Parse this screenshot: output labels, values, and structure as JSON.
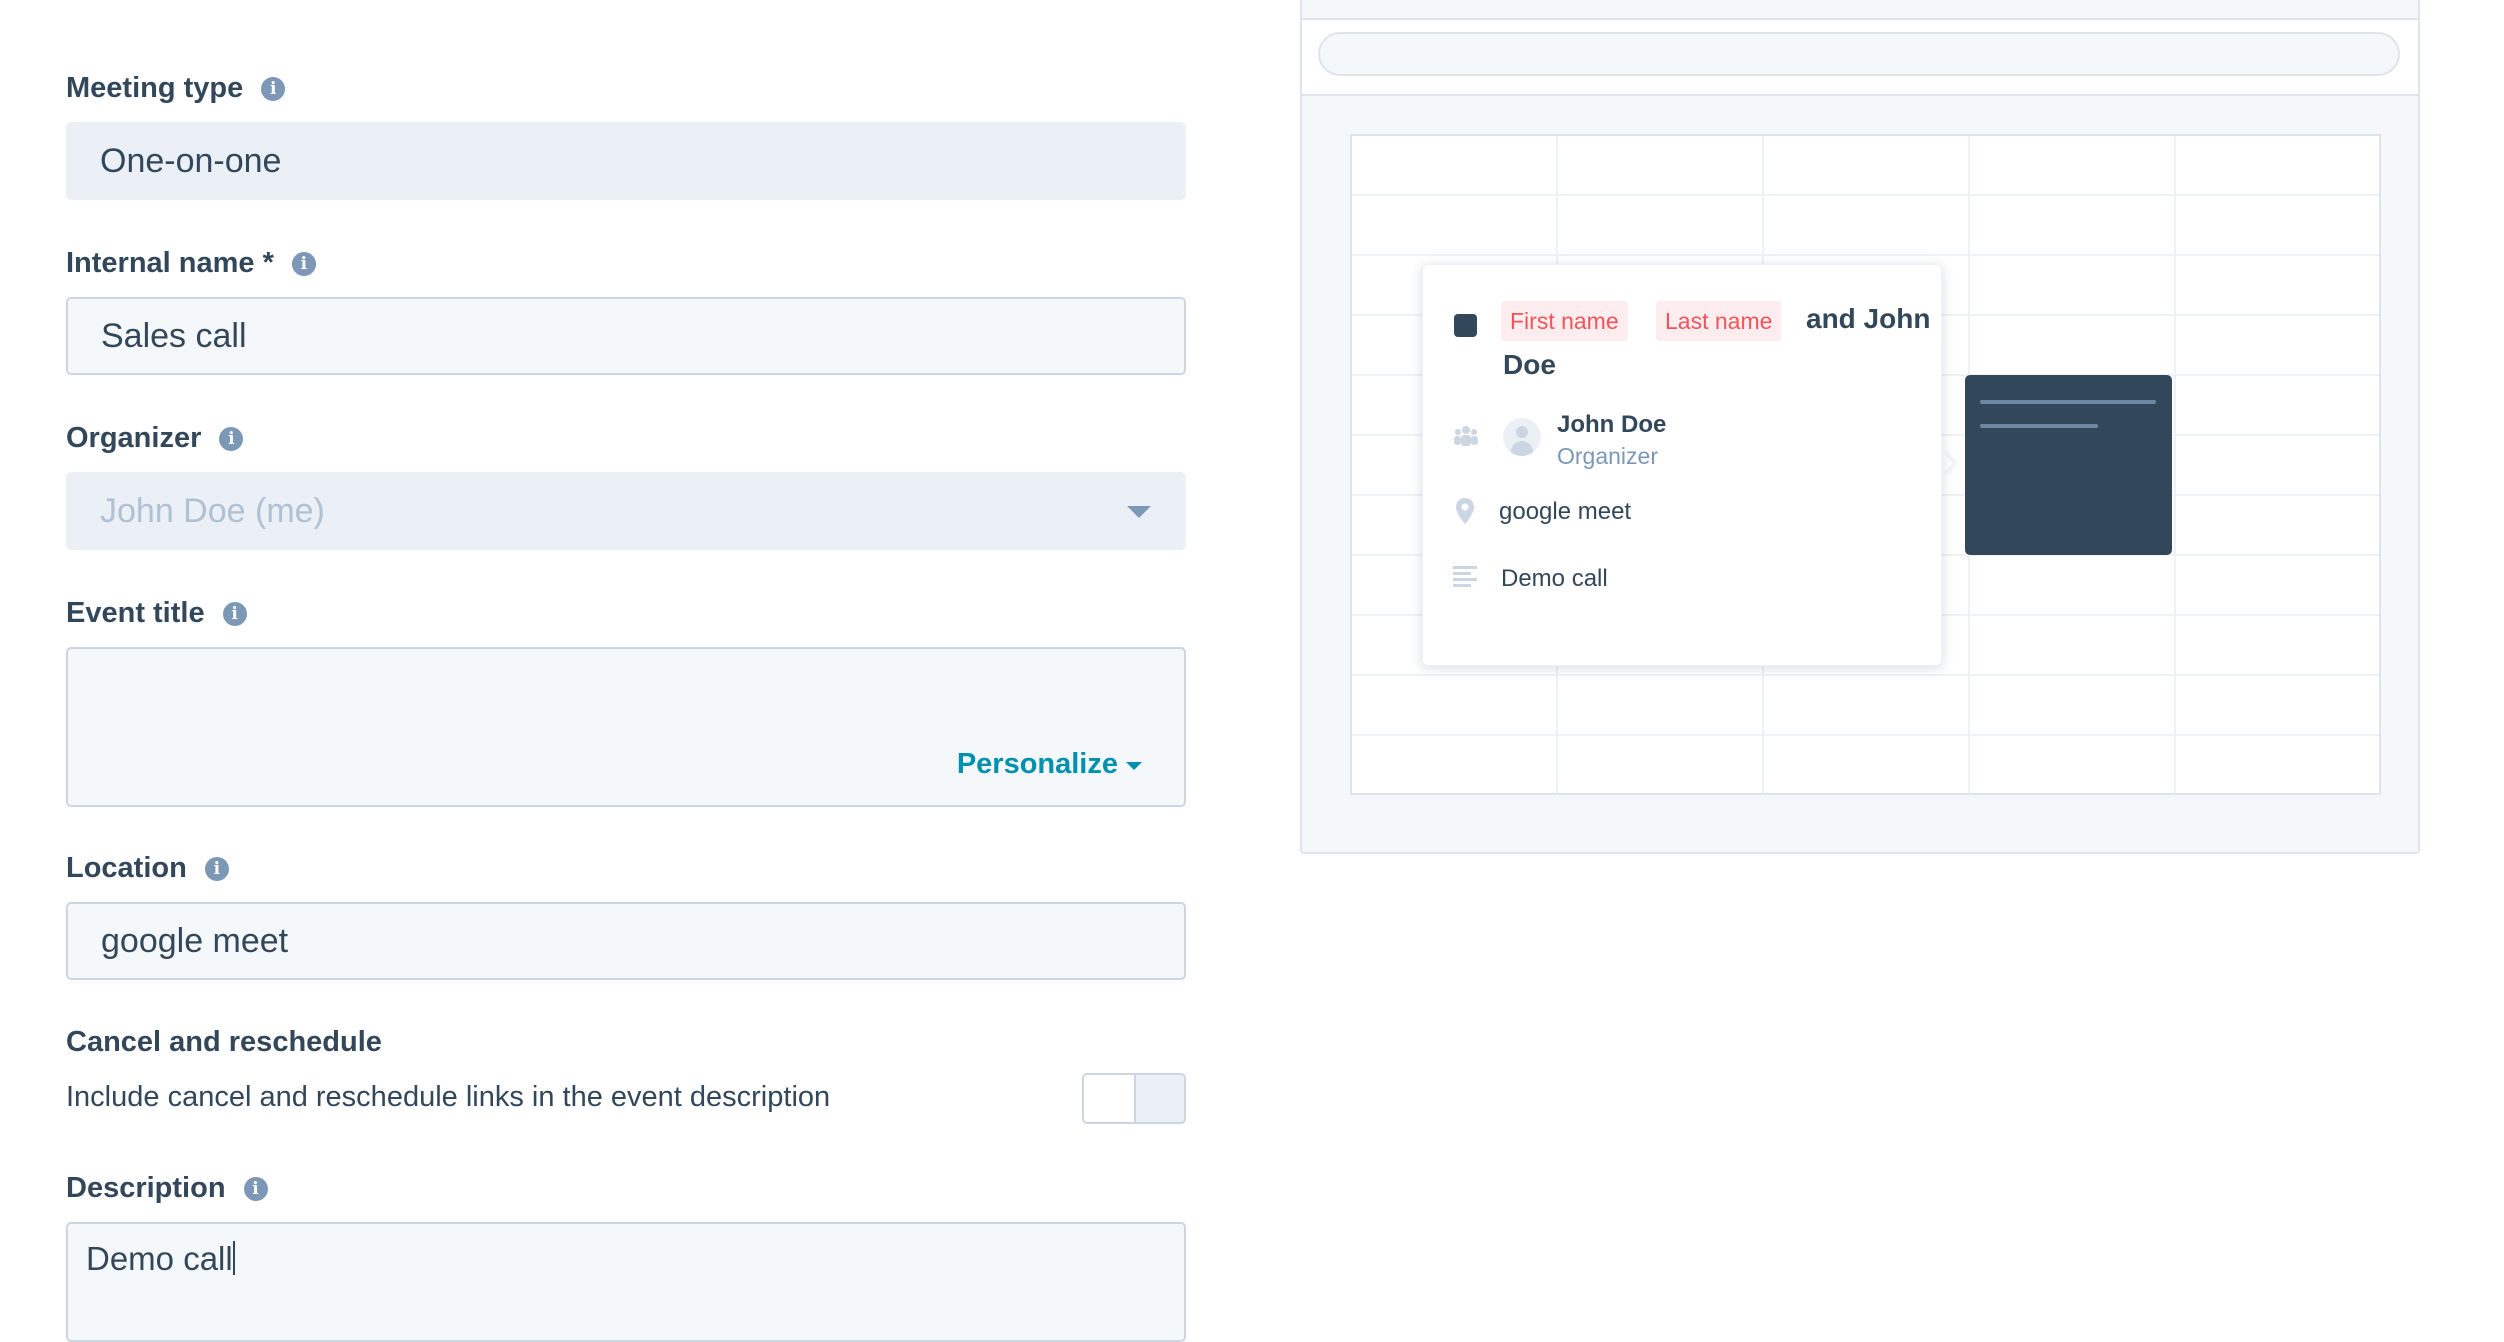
{
  "form": {
    "meeting_type": {
      "label": "Meeting type",
      "value": "One-on-one"
    },
    "internal_name": {
      "label": "Internal name *",
      "value": "Sales call"
    },
    "organizer": {
      "label": "Organizer",
      "value": "John Doe (me)"
    },
    "event_title": {
      "label": "Event title",
      "value": "",
      "personalize_label": "Personalize"
    },
    "location": {
      "label": "Location",
      "value": "google meet"
    },
    "cancel_reschedule": {
      "label": "Cancel and reschedule",
      "description": "Include cancel and reschedule links in the event description",
      "enabled": false
    },
    "description": {
      "label": "Description",
      "value": "Demo call"
    }
  },
  "preview": {
    "event": {
      "first_name_token": "First name",
      "last_name_token": "Last name",
      "title_suffix_part1": "and John",
      "title_suffix_part2": "Doe",
      "organizer_name": "John Doe",
      "organizer_role": "Organizer",
      "location": "google meet",
      "description": "Demo call"
    }
  },
  "icons": {
    "info": "info-icon",
    "dropdown": "caret-down-icon",
    "attendees": "people-icon",
    "location": "map-pin-icon",
    "description": "text-lines-icon",
    "avatar": "user-avatar-icon",
    "color": "calendar-color-square-icon"
  },
  "colors": {
    "text_primary": "#33475b",
    "link": "#0091ae",
    "token_bg": "#fdedee",
    "token_text": "#f2545b",
    "field_bg": "#f5f8fa",
    "readonly_bg": "#eaf0f6",
    "event_block": "#33475b"
  }
}
